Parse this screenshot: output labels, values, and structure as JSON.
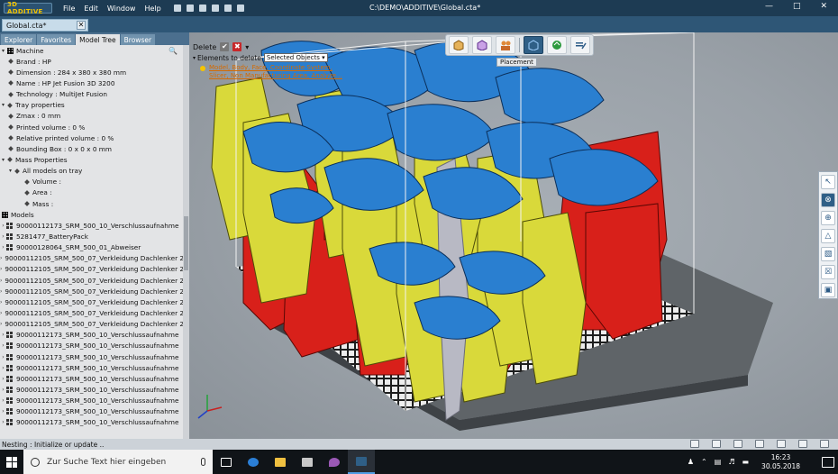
{
  "app": {
    "logo_text": "3D ADDITIVE",
    "menu": [
      "File",
      "Edit",
      "Window",
      "Help"
    ],
    "title": "C:\\DEMO\\ADDITIVE\\Global.cta*",
    "window_controls": [
      "—",
      "□",
      "✕"
    ]
  },
  "doc_tab": {
    "label": "Global.cta*",
    "close": "✕"
  },
  "left_tabs": [
    "Explorer",
    "Favorites",
    "Model Tree",
    "Browser"
  ],
  "tree": {
    "machine": "Machine",
    "machine_props": [
      "Brand : HP",
      "Dimension : 284 x 380 x 380 mm",
      "Name : HP Jet Fusion 3D 3200",
      "Technology : MultiJet Fusion"
    ],
    "tray": "Tray properties",
    "tray_props": [
      "Zmax : 0 mm",
      "Printed volume : 0  %",
      "Relative printed volume : 0  %",
      "Bounding Box : 0 x 0 x 0 mm"
    ],
    "mass": "Mass Properties",
    "all_models": "All models on tray",
    "mass_props": [
      "Volume :",
      "Area :",
      "Mass :"
    ],
    "models_label": "Models",
    "models": [
      "90000112173_SRM_500_10_Verschlussaufnahme",
      "5281477_BatteryPack",
      "90000128064_SRM_500_01_Abweiser",
      "90000112105_SRM_500_07_Verkleidung Dachlenker 2",
      "90000112105_SRM_500_07_Verkleidung Dachlenker 2",
      "90000112105_SRM_500_07_Verkleidung Dachlenker 2",
      "90000112105_SRM_500_07_Verkleidung Dachlenker 2",
      "90000112105_SRM_500_07_Verkleidung Dachlenker 2",
      "90000112105_SRM_500_07_Verkleidung Dachlenker 2",
      "90000112105_SRM_500_07_Verkleidung Dachlenker 2",
      "90000112173_SRM_500_10_Verschlussaufnahme",
      "90000112173_SRM_500_10_Verschlussaufnahme",
      "90000112173_SRM_500_10_Verschlussaufnahme",
      "90000112173_SRM_500_10_Verschlussaufnahme",
      "90000112173_SRM_500_10_Verschlussaufnahme",
      "90000112173_SRM_500_10_Verschlussaufnahme",
      "90000112173_SRM_500_10_Verschlussaufnahme",
      "90000112173_SRM_500_10_Verschlussaufnahme",
      "90000112173_SRM_500_10_Verschlussaufnahme"
    ]
  },
  "delete_panel": {
    "title": "Delete",
    "ok": "✔",
    "cancel": "✖",
    "elements_label": "Elements to delete",
    "selected": "Selected Objects ▾",
    "hint": "Model, Body, Face, Coordinate System, Slicer, Non Manufacturing Area, Analyze..."
  },
  "toolbar": {
    "tooltip": "Placement",
    "buttons": [
      "box-icon",
      "cube-icon",
      "people-icon",
      "cube-frame-icon",
      "green-arrow-icon",
      "edit-icon"
    ]
  },
  "right_toolbar": [
    "↖",
    "⊗",
    "⊕",
    "△",
    "▧",
    "☒",
    "▣"
  ],
  "status_text": "Nesting : Initialize or update ..",
  "taskbar": {
    "search_placeholder": "Zur Suche Text hier eingeben",
    "time": "16:23",
    "date": "30.05.2018"
  },
  "colors": {
    "title": "#1d3b53",
    "red_part": "#d8201a",
    "yellow_part": "#d9d93a",
    "blue_part": "#2a7fd0",
    "viewport": "#9ea5ac"
  }
}
